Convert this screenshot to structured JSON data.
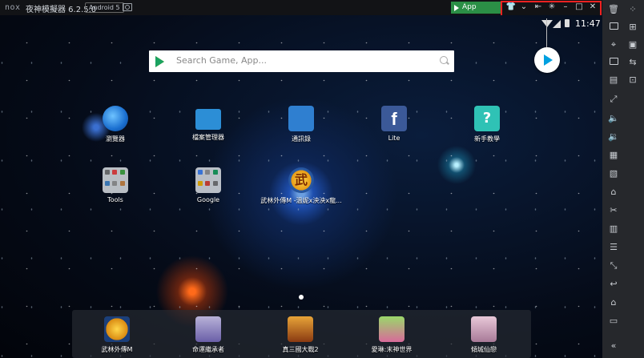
{
  "titlebar": {
    "logo": "nox",
    "title": "夜神模擬器 6.2.5.0",
    "android": "Android 5",
    "app_center": "App Center",
    "controls": [
      "shirt-icon",
      "chevron-down-icon",
      "pin-icon",
      "gear-icon",
      "minimize-icon",
      "maximize-icon",
      "close-icon"
    ]
  },
  "status_bar": {
    "time": "11:47"
  },
  "search": {
    "placeholder": "Search Game, App..."
  },
  "home_apps": [
    {
      "label": "瀏覽器"
    },
    {
      "label": "檔案管理器"
    },
    {
      "label": "通訊錄"
    },
    {
      "label": "Lite"
    },
    {
      "label": "新手教學"
    },
    {
      "label": "Tools"
    },
    {
      "label": "Google"
    },
    {
      "label": "武林外傳M -溫妮x泱泱x龍..."
    }
  ],
  "dock": [
    {
      "label": "武林外傳M"
    },
    {
      "label": "命運繼承者"
    },
    {
      "label": "真三國大戰2"
    },
    {
      "label": "愛琳:末神世界"
    },
    {
      "label": "傾城仙戀"
    }
  ],
  "icons": {
    "wulin_glyph": "武",
    "fb_glyph": "f",
    "teach_glyph": "?"
  },
  "sidebar": {
    "items": [
      "trash-icon",
      "expand-icon",
      "keyboard-icon",
      "gamepad-icon",
      "location-icon",
      "shake-icon",
      "screen-icon",
      "controls-icon",
      "record-icon",
      "macro-icon",
      "fullscreen-icon",
      "volume-up-icon",
      "volume-down-icon",
      "toolbox-icon",
      "apk-icon",
      "import-icon",
      "scissors-icon",
      "multi-instance-icon",
      "menu-icon",
      "resize-icon",
      "back-icon",
      "home-icon",
      "recents-icon",
      "collapse-icon"
    ]
  }
}
